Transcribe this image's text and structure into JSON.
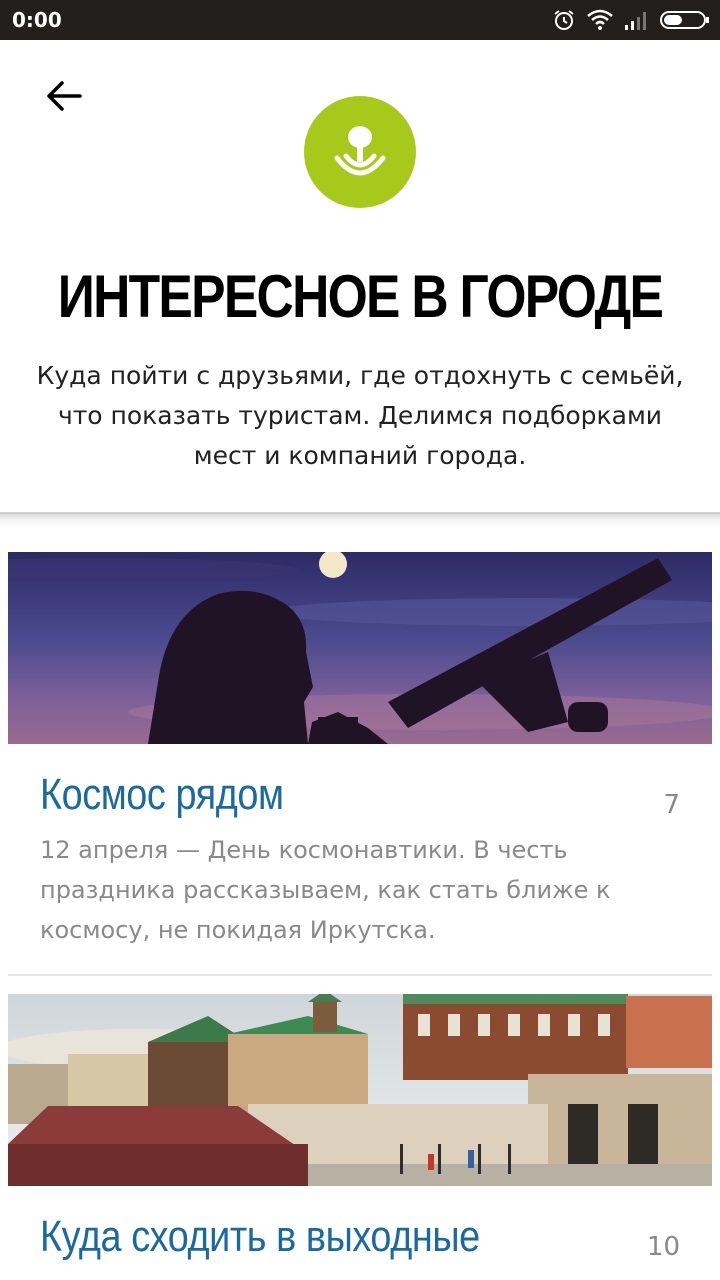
{
  "status_bar": {
    "time": "0:00"
  },
  "header": {
    "title": "ИНТЕРЕСНОЕ В ГОРОДЕ",
    "description": "Куда пойти с друзьями, где отдохнуть с семьёй, что показать туристам. Делимся подборками мест и компаний города.",
    "logo_color": "#a8c81c"
  },
  "cards": [
    {
      "title": "Космос рядом",
      "count": "7",
      "description": "12 апреля — День космонавтики. В честь праздника рассказываем, как стать ближе к космосу, не покидая Иркутска."
    },
    {
      "title": "Куда сходить в выходные",
      "count": "10"
    }
  ],
  "colors": {
    "title_blue": "#1a6aa0",
    "muted": "#8a8a8a",
    "status_bg": "#231f1c"
  }
}
